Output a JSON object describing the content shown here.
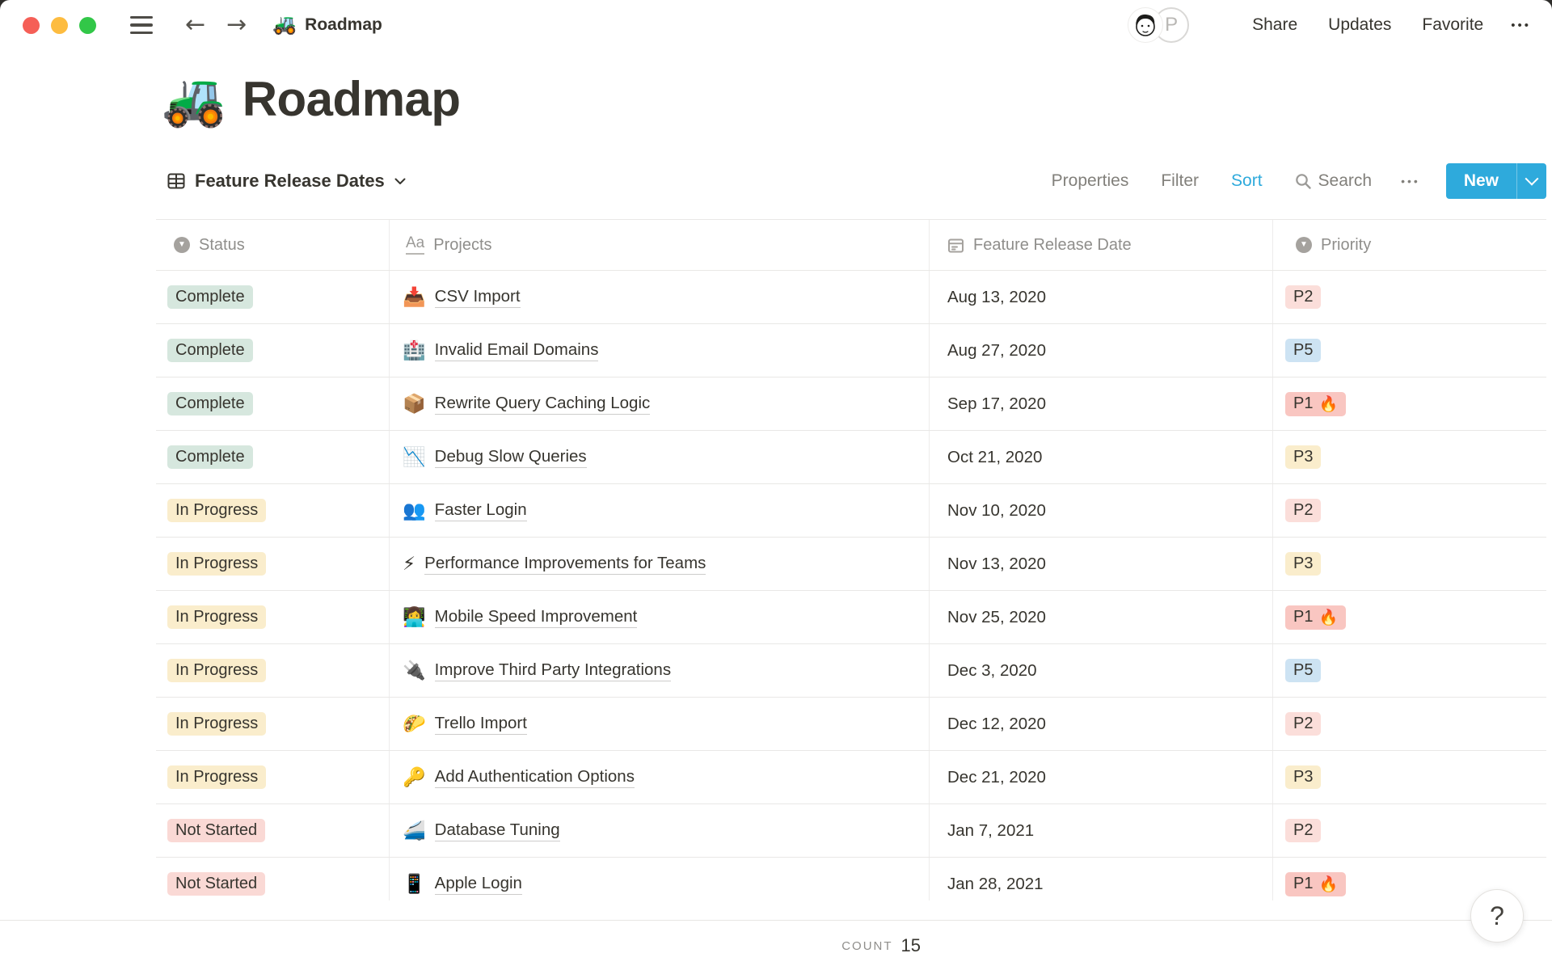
{
  "window": {
    "breadcrumb_icon": "🚜",
    "breadcrumb": "Roadmap"
  },
  "topbar": {
    "avatar_initial": "P",
    "share": "Share",
    "updates": "Updates",
    "favorite": "Favorite",
    "more": "•••"
  },
  "page": {
    "icon": "🚜",
    "title": "Roadmap"
  },
  "toolbar": {
    "view_name": "Feature Release Dates",
    "properties": "Properties",
    "filter": "Filter",
    "sort": "Sort",
    "search": "Search",
    "more": "•••",
    "new_label": "New"
  },
  "table": {
    "columns": [
      {
        "label": "Status",
        "icon": "select-icon"
      },
      {
        "label": "Projects",
        "icon": "text-Aa-icon"
      },
      {
        "label": "Feature Release Date",
        "icon": "calendar-icon"
      },
      {
        "label": "Priority",
        "icon": "select-icon"
      }
    ],
    "fire_icon": "🔥",
    "rows": [
      {
        "status": "Complete",
        "status_color": "green",
        "icon": "📥",
        "icon_name": "inbox-tray",
        "project": "CSV Import",
        "date": "Aug 13, 2020",
        "priority": "P2",
        "priority_color": "p2",
        "fire": false
      },
      {
        "status": "Complete",
        "status_color": "green",
        "icon": "🏥",
        "icon_name": "hospital",
        "project": "Invalid Email Domains",
        "date": "Aug 27, 2020",
        "priority": "P5",
        "priority_color": "p5",
        "fire": false
      },
      {
        "status": "Complete",
        "status_color": "green",
        "icon": "📦",
        "icon_name": "package",
        "project": "Rewrite Query Caching Logic",
        "date": "Sep 17, 2020",
        "priority": "P1",
        "priority_color": "p1",
        "fire": true
      },
      {
        "status": "Complete",
        "status_color": "green",
        "icon": "📉",
        "icon_name": "chart-decreasing",
        "project": "Debug Slow Queries",
        "date": "Oct 21, 2020",
        "priority": "P3",
        "priority_color": "p3",
        "fire": false
      },
      {
        "status": "In Progress",
        "status_color": "yellow",
        "icon": "👥",
        "icon_name": "busts-in-silhouette",
        "project": "Faster Login",
        "date": "Nov 10, 2020",
        "priority": "P2",
        "priority_color": "p2",
        "fire": false
      },
      {
        "status": "In Progress",
        "status_color": "yellow",
        "icon": "⚡",
        "icon_name": "high-voltage",
        "project": "Performance Improvements for Teams",
        "date": "Nov 13, 2020",
        "priority": "P3",
        "priority_color": "p3",
        "fire": false
      },
      {
        "status": "In Progress",
        "status_color": "yellow",
        "icon": "👩‍💻",
        "icon_name": "technologist",
        "project": "Mobile Speed Improvement",
        "date": "Nov 25, 2020",
        "priority": "P1",
        "priority_color": "p1",
        "fire": true
      },
      {
        "status": "In Progress",
        "status_color": "yellow",
        "icon": "🔌",
        "icon_name": "electric-plug",
        "project": "Improve Third Party Integrations",
        "date": "Dec 3, 2020",
        "priority": "P5",
        "priority_color": "p5",
        "fire": false
      },
      {
        "status": "In Progress",
        "status_color": "yellow",
        "icon": "🌮",
        "icon_name": "taco",
        "project": "Trello Import",
        "date": "Dec 12, 2020",
        "priority": "P2",
        "priority_color": "p2",
        "fire": false
      },
      {
        "status": "In Progress",
        "status_color": "yellow",
        "icon": "🔑",
        "icon_name": "key",
        "project": "Add Authentication Options",
        "date": "Dec 21, 2020",
        "priority": "P3",
        "priority_color": "p3",
        "fire": false
      },
      {
        "status": "Not Started",
        "status_color": "pink",
        "icon": "🚄",
        "icon_name": "high-speed-train",
        "project": "Database Tuning",
        "date": "Jan 7, 2021",
        "priority": "P2",
        "priority_color": "p2",
        "fire": false
      },
      {
        "status": "Not Started",
        "status_color": "pink",
        "icon": "📱",
        "icon_name": "mobile-phone",
        "project": "Apple Login",
        "date": "Jan 28, 2021",
        "priority": "P1",
        "priority_color": "p1",
        "fire": true
      }
    ]
  },
  "footer": {
    "count_label": "COUNT",
    "count_value": "15"
  },
  "help": {
    "label": "?"
  },
  "colors": {
    "green": "#D6E7DE",
    "yellow": "#FAEDCC",
    "pink": "#FAD9D5",
    "p1": "#F9C6C1",
    "p2": "#FBDEDA",
    "p3": "#FAEDCC",
    "p5": "#CDE3F3",
    "accent": "#2EAADC"
  }
}
